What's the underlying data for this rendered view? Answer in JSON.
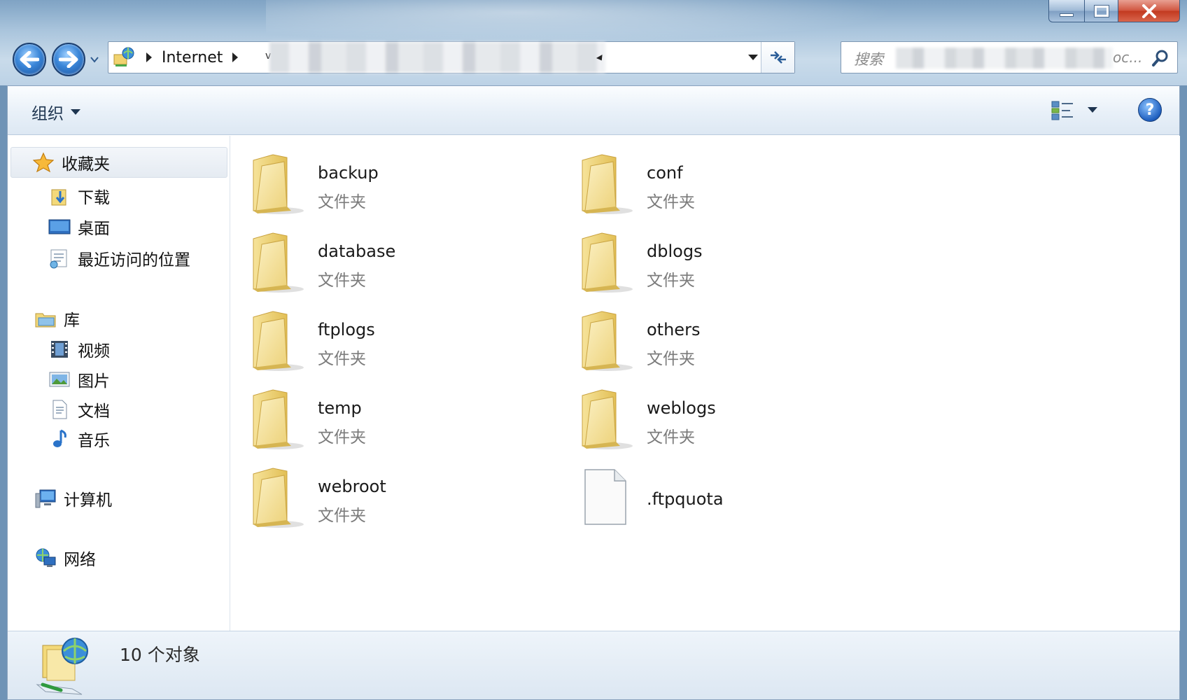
{
  "window": {
    "caption": {
      "minimize": "minimize",
      "maximize": "maximize",
      "close": "close"
    }
  },
  "address": {
    "segment": "Internet",
    "small_text": "v"
  },
  "search": {
    "placeholder": "搜索",
    "tail": "oc..."
  },
  "toolbar": {
    "organize_label": "组织",
    "help_label": "?"
  },
  "nav": {
    "favorites": "收藏夹",
    "downloads": "下载",
    "desktop": "桌面",
    "recent": "最近访问的位置",
    "libraries": "库",
    "videos": "视频",
    "pictures": "图片",
    "documents": "文档",
    "music": "音乐",
    "computer": "计算机",
    "network": "网络"
  },
  "files": [
    {
      "name": "backup",
      "type": "文件夹",
      "kind": "folder"
    },
    {
      "name": "conf",
      "type": "文件夹",
      "kind": "folder"
    },
    {
      "name": "database",
      "type": "文件夹",
      "kind": "folder"
    },
    {
      "name": "dblogs",
      "type": "文件夹",
      "kind": "folder"
    },
    {
      "name": "ftplogs",
      "type": "文件夹",
      "kind": "folder"
    },
    {
      "name": "others",
      "type": "文件夹",
      "kind": "folder"
    },
    {
      "name": "temp",
      "type": "文件夹",
      "kind": "folder"
    },
    {
      "name": "weblogs",
      "type": "文件夹",
      "kind": "folder"
    },
    {
      "name": "webroot",
      "type": "文件夹",
      "kind": "folder"
    },
    {
      "name": ".ftpquota",
      "type": "",
      "kind": "file"
    }
  ],
  "status": {
    "count_text": "10 个对象"
  },
  "colors": {
    "accent": "#3a86d8",
    "folder_yellow": "#f3d97a",
    "close_red": "#c2391f"
  }
}
